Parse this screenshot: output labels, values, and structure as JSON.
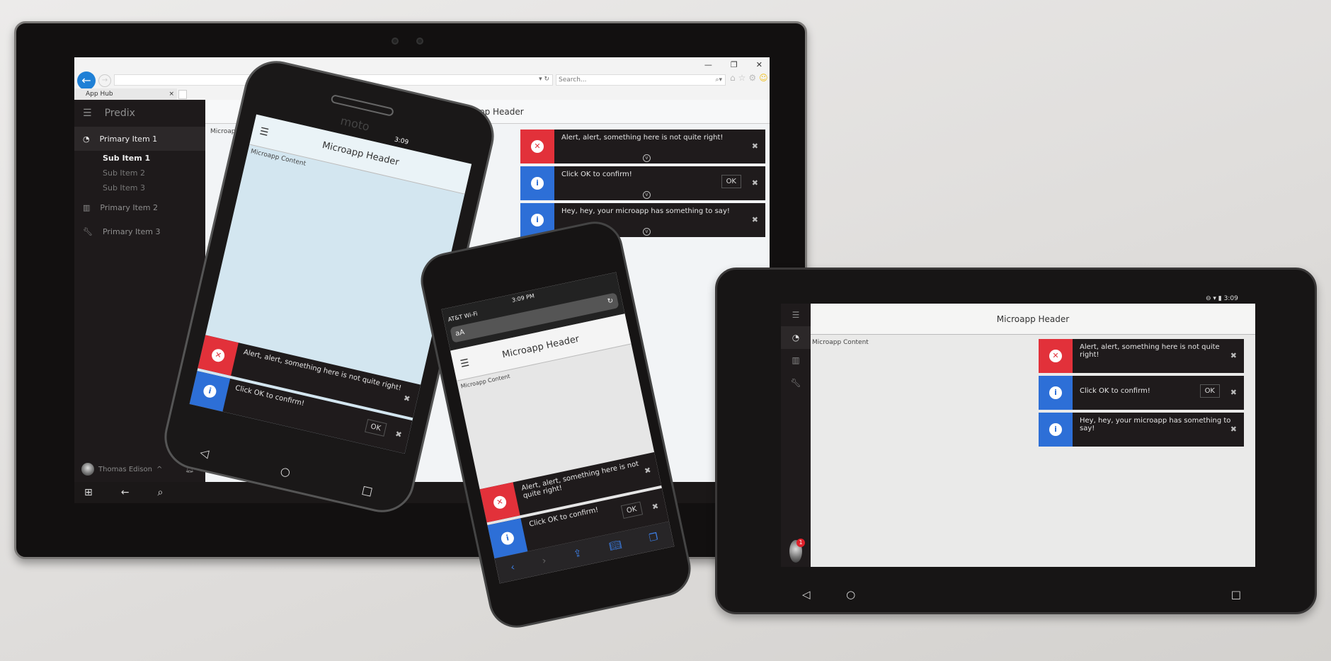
{
  "browser": {
    "tab_label": "App Hub",
    "search_placeholder": "Search...",
    "window_controls": [
      "—",
      "❐",
      "✕"
    ],
    "toolbar_icons": [
      "home-icon",
      "star-icon",
      "gear-icon",
      "smiley-icon"
    ]
  },
  "app": {
    "brand": "Predix",
    "header": "Microapp Header",
    "content": "Microapp Content",
    "nav": [
      {
        "label": "Primary Item 1",
        "icon": "dashboard-icon",
        "active": true,
        "subitems": [
          {
            "label": "Sub Item 1",
            "active": true
          },
          {
            "label": "Sub Item 2"
          },
          {
            "label": "Sub Item 3"
          }
        ]
      },
      {
        "label": "Primary Item 2",
        "icon": "chart-icon"
      },
      {
        "label": "Primary Item 3",
        "icon": "wrench-icon"
      }
    ],
    "user": {
      "name": "Thomas Edison",
      "notifications": "1"
    },
    "alerts": [
      {
        "type": "error",
        "message": "Alert, alert, something here is not quite right!",
        "color": "#e2313a"
      },
      {
        "type": "info",
        "message": "Click OK to confirm!",
        "action": "OK",
        "color": "#2d6fd7"
      },
      {
        "type": "info",
        "message": "Hey, hey, your microapp has something to say!",
        "color": "#2d6fd7"
      }
    ]
  },
  "devices": {
    "moto": {
      "brand": "moto",
      "time": "3:09"
    },
    "iphone": {
      "carrier": "AT&T Wi-Fi",
      "time": "3:09 PM",
      "url_text": "aA"
    },
    "nexus": {
      "time": "3:09"
    }
  }
}
